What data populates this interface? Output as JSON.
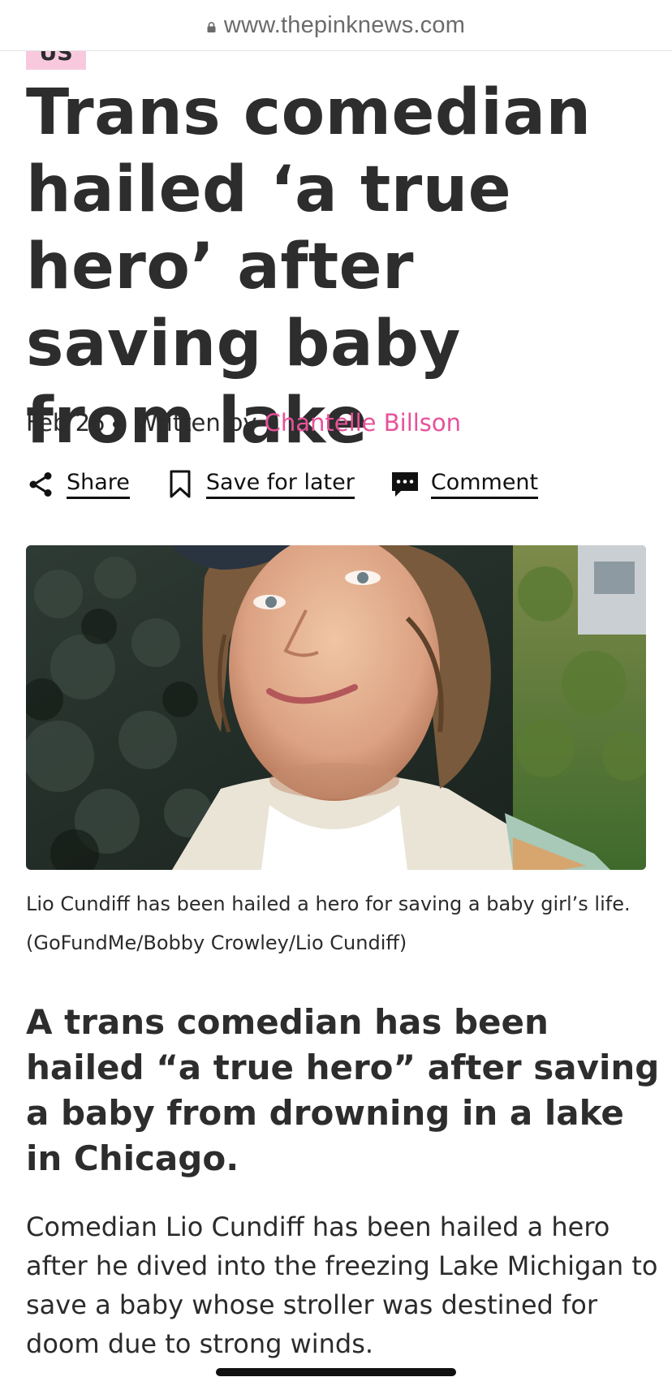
{
  "browser": {
    "url": "www.thepinknews.com",
    "lock_icon": "lock-icon"
  },
  "article": {
    "category": "US",
    "headline": "Trans comedian hailed ‘a true hero’ after saving baby from lake",
    "date": "Feb 26",
    "written_by": "Written by",
    "author": "Chantelle Billson",
    "actions": {
      "share": "Share",
      "save": "Save for later",
      "comment": "Comment"
    },
    "caption": "Lio Cundiff has been hailed a hero for saving a baby girl’s life. (GoFundMe/Bobby Crowley/Lio Cundiff)",
    "standfirst": "A trans comedian has been hailed “a true hero” after saving a baby from drowning in a lake in Chicago.",
    "body": "Comedian Lio Cundiff has been hailed a hero after he dived into the freezing Lake Michigan to save a baby whose stroller was destined for doom due to strong winds."
  },
  "colors": {
    "accent_pink": "#e8519a",
    "tag_pink": "#f8c9dd",
    "text_dark": "#2b2b2b"
  },
  "icons": [
    "lock-icon",
    "share-icon",
    "bookmark-icon",
    "comment-icon"
  ]
}
